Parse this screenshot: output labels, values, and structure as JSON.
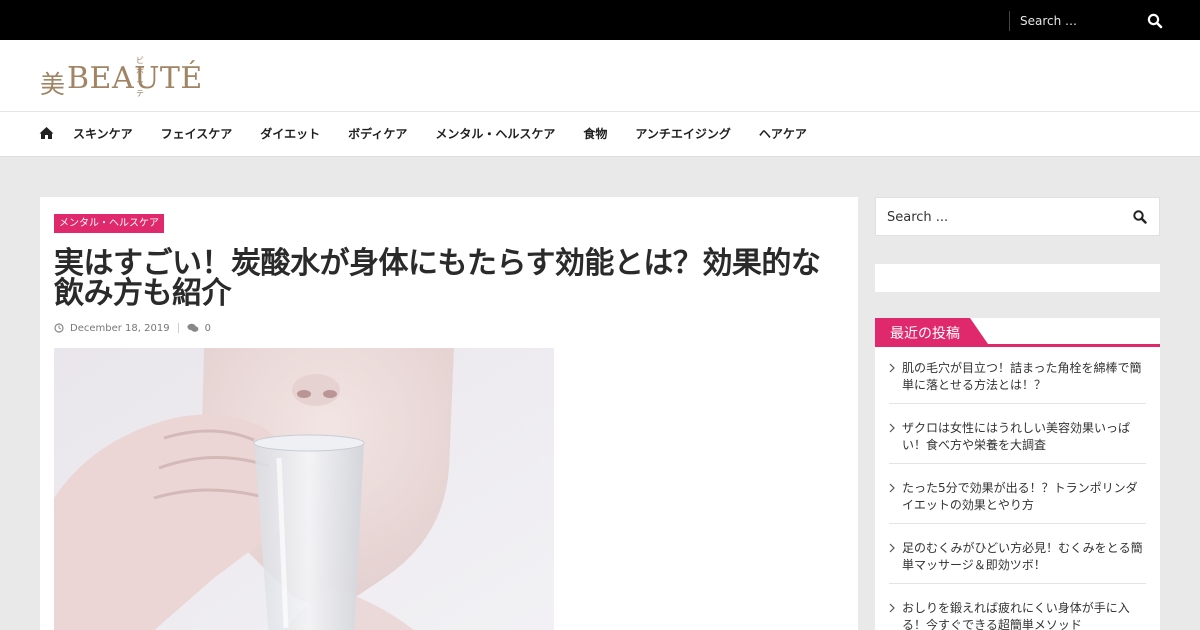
{
  "topbar": {
    "search_placeholder": "Search …"
  },
  "header": {
    "logo_kanji": "美",
    "logo_word": "BEAUTÉ",
    "logo_ruby": "ビボーテ"
  },
  "nav": {
    "items": [
      {
        "label": "スキンケア"
      },
      {
        "label": "フェイスケア"
      },
      {
        "label": "ダイエット"
      },
      {
        "label": "ボディケア"
      },
      {
        "label": "メンタル・ヘルスケア"
      },
      {
        "label": "食物"
      },
      {
        "label": "アンチエイジング"
      },
      {
        "label": "ヘアケア"
      }
    ]
  },
  "article": {
    "category": "メンタル・ヘルスケア",
    "title": "実はすごい！炭酸水が身体にもたらす効能とは？効果的な飲み方も紹介",
    "date": "December 18, 2019",
    "comments": "0"
  },
  "sidebar": {
    "search_placeholder": "Search ...",
    "recent_title": "最近の投稿",
    "recent_posts": [
      {
        "title": "肌の毛穴が目立つ！詰まった角栓を綿棒で簡単に落とせる方法とは！？"
      },
      {
        "title": "ザクロは女性にはうれしい美容効果いっぱい！食べ方や栄養を大調査"
      },
      {
        "title": "たった5分で効果が出る！？トランポリンダイエットの効果とやり方"
      },
      {
        "title": "足のむくみがひどい方必見！むくみをとる簡単マッサージ＆即効ツボ！"
      },
      {
        "title": "おしりを鍛えれば疲れにくい身体が手に入る！今すぐできる超簡単メソッド"
      }
    ]
  },
  "colors": {
    "accent": "#e0286c",
    "logo": "#a08464",
    "topbar": "#000000",
    "page_bg": "#e9e9e9"
  }
}
